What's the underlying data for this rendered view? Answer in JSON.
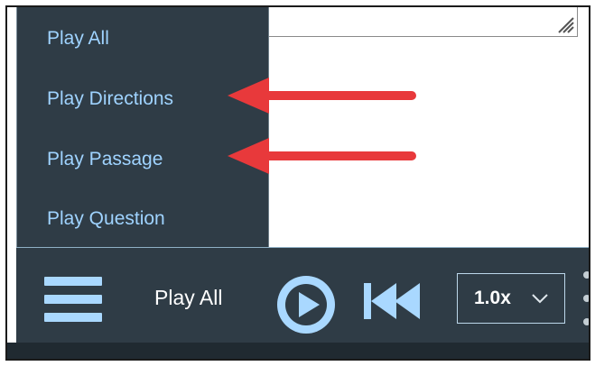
{
  "menu": {
    "items": [
      {
        "label": "Play All"
      },
      {
        "label": "Play Directions"
      },
      {
        "label": "Play Passage"
      },
      {
        "label": "Play Question"
      }
    ]
  },
  "player": {
    "current_label": "Play All",
    "speed": "1.0x",
    "icons": {
      "menu": "hamburger-icon",
      "play": "play-icon",
      "rewind": "rewind-icon",
      "speed_dropdown": "chevron-down-icon",
      "more": "kebab-menu-icon"
    }
  },
  "annotations": {
    "arrow_color": "#e8393b",
    "arrows_point_to": [
      "Play Directions",
      "Play Passage"
    ]
  },
  "colors": {
    "panel_bg": "#2f3c46",
    "menu_text": "#9fd3ff",
    "icon_blue": "#a9d8ff"
  }
}
